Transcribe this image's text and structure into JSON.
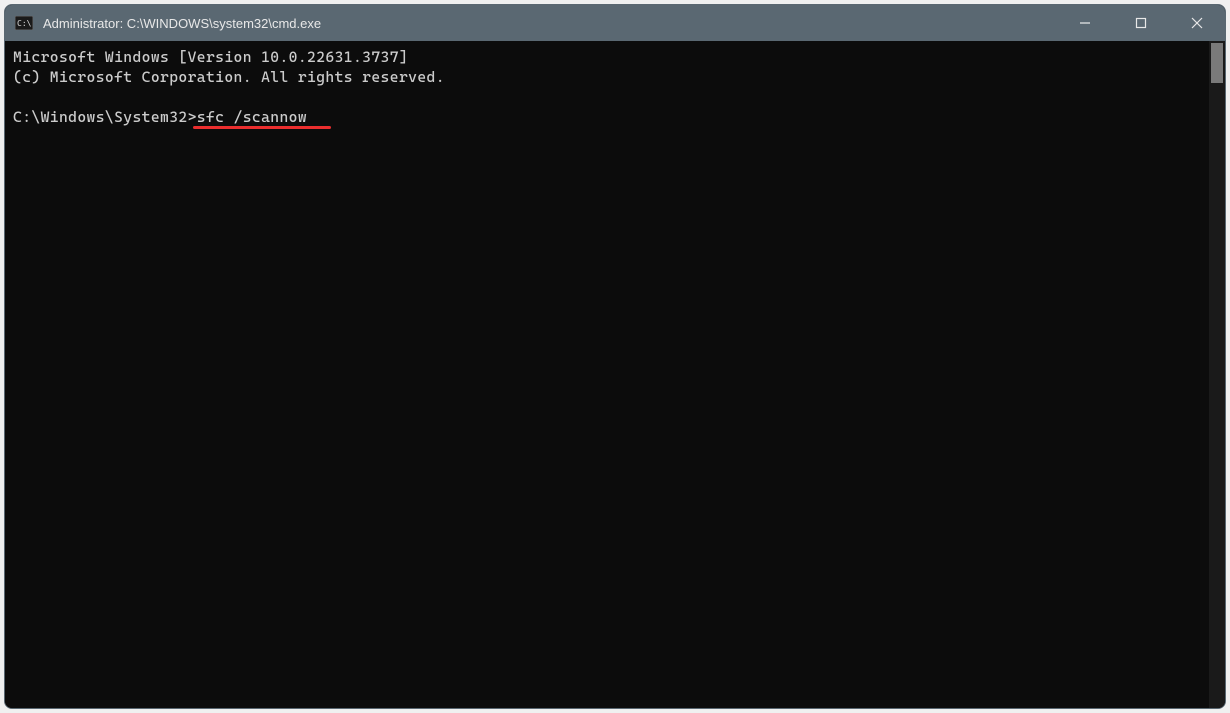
{
  "titlebar": {
    "title": "Administrator: C:\\WINDOWS\\system32\\cmd.exe"
  },
  "terminal": {
    "line1": "Microsoft Windows [Version 10.0.22631.3737]",
    "line2": "(c) Microsoft Corporation. All rights reserved.",
    "prompt": "C:\\Windows\\System32>",
    "command": "sfc /scannow"
  },
  "annotation": {
    "underline_target": "sfc /scannow",
    "underline_color": "#eb2e2e"
  },
  "colors": {
    "titlebar_bg": "#5a6872",
    "terminal_bg": "#0c0c0c",
    "terminal_fg": "#cccccc"
  }
}
